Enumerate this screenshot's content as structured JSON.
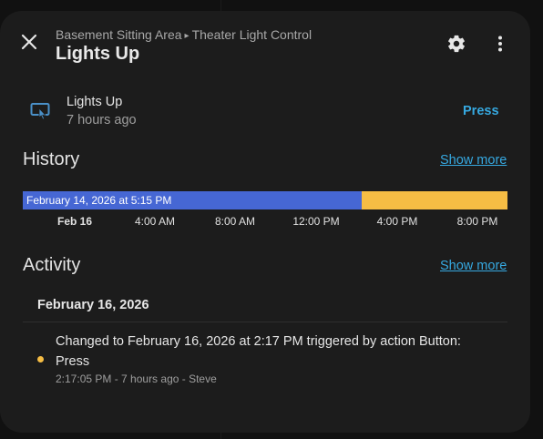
{
  "header": {
    "breadcrumb_area": "Basement Sitting Area",
    "breadcrumb_separator": "▸",
    "breadcrumb_device": "Theater Light Control",
    "title": "Lights Up",
    "icons": {
      "close": "close-icon",
      "settings": "gear-icon",
      "more": "more-vertical-icon"
    }
  },
  "entity": {
    "icon": "gesture-tap-button-icon",
    "name": "Lights Up",
    "last_changed": "7 hours ago",
    "action_label": "Press"
  },
  "history": {
    "title": "History",
    "show_more": "Show more",
    "segments": [
      {
        "label": "February 14, 2026 at 5:15 PM",
        "color": "#4667d4",
        "fraction": 0.7
      },
      {
        "label": "",
        "color": "#f6bd44",
        "fraction": 0.3
      }
    ],
    "ticks": [
      "Feb 16",
      "4:00 AM",
      "8:00 AM",
      "12:00 PM",
      "4:00 PM",
      "8:00 PM"
    ]
  },
  "activity": {
    "title": "Activity",
    "show_more": "Show more",
    "day": "February 16, 2026",
    "entries": [
      {
        "text": "Changed to February 16, 2026 at 2:17 PM triggered by action Button: Press",
        "meta": "2:17:05 PM - 7 hours ago - Steve",
        "dot_color": "#f6bd44"
      }
    ]
  },
  "colors": {
    "accent": "#36a9e1",
    "dialog_bg": "#1c1c1c",
    "history_on": "#4667d4",
    "history_recent": "#f6bd44"
  }
}
